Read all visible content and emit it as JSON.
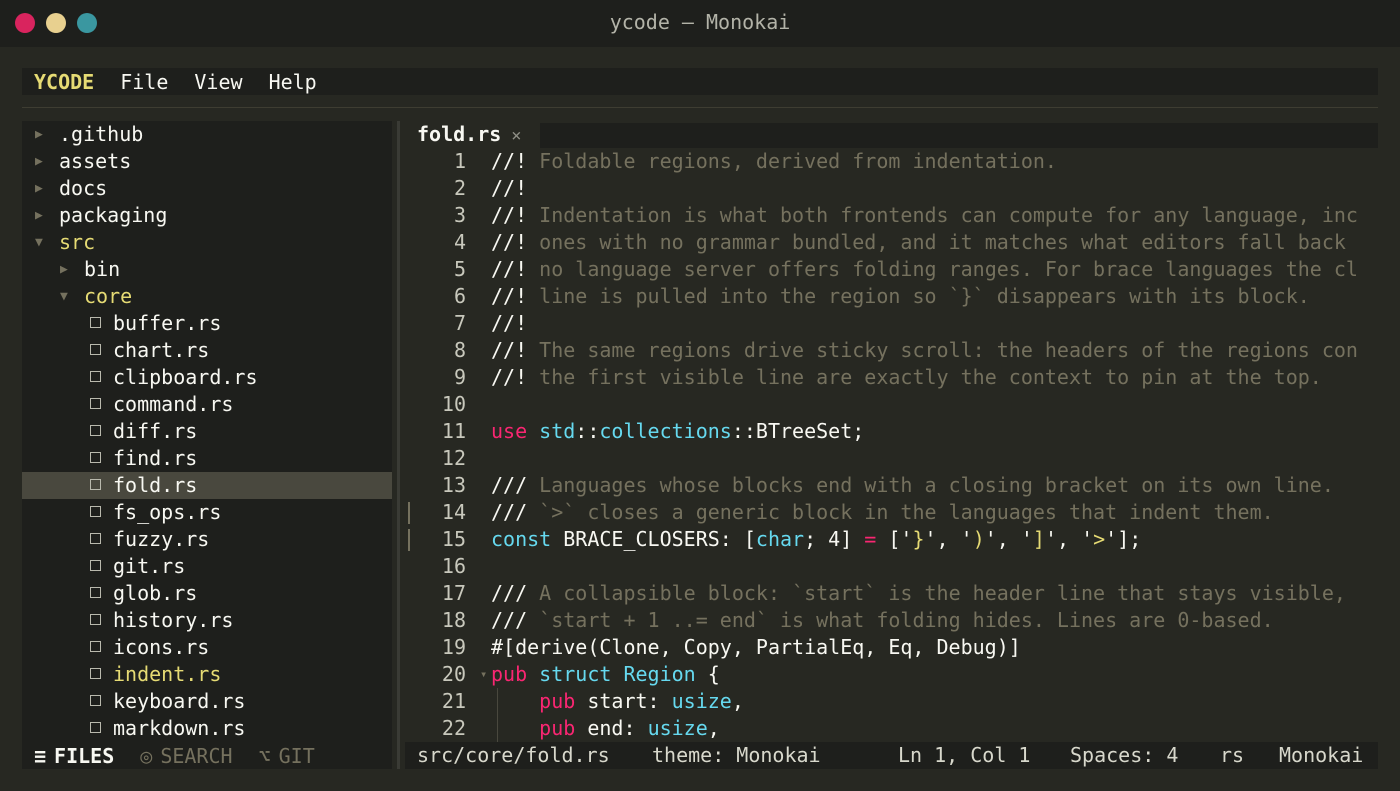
{
  "window": {
    "title": "ycode — Monokai"
  },
  "menu": {
    "brand": "YCODE",
    "items": [
      "File",
      "View",
      "Help"
    ]
  },
  "sidebar": {
    "tree": [
      {
        "name": ".github",
        "kind": "dir",
        "depth": 0,
        "open": false
      },
      {
        "name": "assets",
        "kind": "dir",
        "depth": 0,
        "open": false
      },
      {
        "name": "docs",
        "kind": "dir",
        "depth": 0,
        "open": false
      },
      {
        "name": "packaging",
        "kind": "dir",
        "depth": 0,
        "open": false
      },
      {
        "name": "src",
        "kind": "dir",
        "depth": 0,
        "open": true
      },
      {
        "name": "bin",
        "kind": "dir",
        "depth": 1,
        "open": false
      },
      {
        "name": "core",
        "kind": "dir",
        "depth": 1,
        "open": true
      },
      {
        "name": "buffer.rs",
        "kind": "file",
        "depth": 2
      },
      {
        "name": "chart.rs",
        "kind": "file",
        "depth": 2
      },
      {
        "name": "clipboard.rs",
        "kind": "file",
        "depth": 2
      },
      {
        "name": "command.rs",
        "kind": "file",
        "depth": 2
      },
      {
        "name": "diff.rs",
        "kind": "file",
        "depth": 2
      },
      {
        "name": "find.rs",
        "kind": "file",
        "depth": 2
      },
      {
        "name": "fold.rs",
        "kind": "file",
        "depth": 2,
        "selected": true
      },
      {
        "name": "fs_ops.rs",
        "kind": "file",
        "depth": 2
      },
      {
        "name": "fuzzy.rs",
        "kind": "file",
        "depth": 2
      },
      {
        "name": "git.rs",
        "kind": "file",
        "depth": 2
      },
      {
        "name": "glob.rs",
        "kind": "file",
        "depth": 2
      },
      {
        "name": "history.rs",
        "kind": "file",
        "depth": 2
      },
      {
        "name": "icons.rs",
        "kind": "file",
        "depth": 2
      },
      {
        "name": "indent.rs",
        "kind": "file",
        "depth": 2,
        "modified": true
      },
      {
        "name": "keyboard.rs",
        "kind": "file",
        "depth": 2
      },
      {
        "name": "markdown.rs",
        "kind": "file",
        "depth": 2
      }
    ],
    "tabs": [
      {
        "icon": "≡",
        "label": "FILES",
        "active": true
      },
      {
        "icon": "◎",
        "label": "SEARCH",
        "active": false
      },
      {
        "icon": "⌥",
        "label": "GIT",
        "active": false
      }
    ]
  },
  "editor_tab": {
    "name": "fold.rs",
    "close": "×"
  },
  "editor": {
    "lines": [
      {
        "n": "1",
        "tokens": [
          [
            "df",
            "//! "
          ],
          [
            "cm",
            "Foldable regions, derived from indentation."
          ]
        ]
      },
      {
        "n": "2",
        "tokens": [
          [
            "df",
            "//!"
          ]
        ]
      },
      {
        "n": "3",
        "tokens": [
          [
            "df",
            "//! "
          ],
          [
            "cm",
            "Indentation is what both frontends can compute for any language, inc"
          ]
        ]
      },
      {
        "n": "4",
        "tokens": [
          [
            "df",
            "//! "
          ],
          [
            "cm",
            "ones with no grammar bundled, and it matches what editors fall back"
          ]
        ]
      },
      {
        "n": "5",
        "tokens": [
          [
            "df",
            "//! "
          ],
          [
            "cm",
            "no language server offers folding ranges. For brace languages the cl"
          ]
        ]
      },
      {
        "n": "6",
        "tokens": [
          [
            "df",
            "//! "
          ],
          [
            "cm",
            "line is pulled into the region so `}` disappears with its block."
          ]
        ]
      },
      {
        "n": "7",
        "tokens": [
          [
            "df",
            "//!"
          ]
        ]
      },
      {
        "n": "8",
        "tokens": [
          [
            "df",
            "//! "
          ],
          [
            "cm",
            "The same regions drive sticky scroll: the headers of the regions con"
          ]
        ]
      },
      {
        "n": "9",
        "tokens": [
          [
            "df",
            "//! "
          ],
          [
            "cm",
            "the first visible line are exactly the context to pin at the top."
          ]
        ]
      },
      {
        "n": "10",
        "tokens": []
      },
      {
        "n": "11",
        "tokens": [
          [
            "kw",
            "use "
          ],
          [
            "ty",
            "std"
          ],
          [
            "df",
            "::"
          ],
          [
            "ty",
            "collections"
          ],
          [
            "df",
            "::BTreeSet;"
          ]
        ]
      },
      {
        "n": "12",
        "tokens": []
      },
      {
        "n": "13",
        "tokens": [
          [
            "df",
            "/// "
          ],
          [
            "cm",
            "Languages whose blocks end with a closing bracket on its own line."
          ]
        ]
      },
      {
        "n": "14",
        "mark": true,
        "tokens": [
          [
            "df",
            "/// "
          ],
          [
            "cm",
            "`>` closes a generic block in the languages that indent them."
          ]
        ]
      },
      {
        "n": "15",
        "mark": true,
        "tokens": [
          [
            "ty",
            "const "
          ],
          [
            "df",
            "BRACE_CLOSERS: ["
          ],
          [
            "ty",
            "char"
          ],
          [
            "df",
            "; 4] "
          ],
          [
            "kw",
            "="
          ],
          [
            "df",
            " ['"
          ],
          [
            "st",
            "}"
          ],
          [
            "df",
            "', '"
          ],
          [
            "st",
            ")"
          ],
          [
            "df",
            "', '"
          ],
          [
            "st",
            "]"
          ],
          [
            "df",
            "', '"
          ],
          [
            "st",
            ">"
          ],
          [
            "df",
            "'];"
          ]
        ]
      },
      {
        "n": "16",
        "tokens": []
      },
      {
        "n": "17",
        "tokens": [
          [
            "df",
            "/// "
          ],
          [
            "cm",
            "A collapsible block: `start` is the header line that stays visible,"
          ]
        ]
      },
      {
        "n": "18",
        "tokens": [
          [
            "df",
            "/// "
          ],
          [
            "cm",
            "`start + 1 ..= end` is what folding hides. Lines are 0-based."
          ]
        ]
      },
      {
        "n": "19",
        "tokens": [
          [
            "df",
            "#[derive(Clone, Copy, PartialEq, Eq, Debug)]"
          ]
        ]
      },
      {
        "n": "20",
        "fold": "▾",
        "tokens": [
          [
            "kw",
            "pub "
          ],
          [
            "ty",
            "struct "
          ],
          [
            "ty",
            "Region"
          ],
          [
            "df",
            " {"
          ]
        ]
      },
      {
        "n": "21",
        "guide": true,
        "tokens": [
          [
            "df",
            "    "
          ],
          [
            "kw",
            "pub "
          ],
          [
            "df",
            "start: "
          ],
          [
            "ty",
            "usize"
          ],
          [
            "df",
            ","
          ]
        ]
      },
      {
        "n": "22",
        "guide": true,
        "tokens": [
          [
            "df",
            "    "
          ],
          [
            "kw",
            "pub "
          ],
          [
            "df",
            "end: "
          ],
          [
            "ty",
            "usize"
          ],
          [
            "df",
            ","
          ]
        ]
      }
    ]
  },
  "status": {
    "path": "src/core/fold.rs",
    "theme": "theme: Monokai",
    "position": "Ln 1, Col 1",
    "spaces": "Spaces: 4",
    "lang": "rs",
    "theme_name": "Monokai"
  },
  "colors": {
    "background": "#272822",
    "panel": "#1e1f1c",
    "comment": "#75715e",
    "keyword": "#f92672",
    "type": "#66d9ef",
    "string": "#e6db74",
    "selection": "#49483e"
  }
}
